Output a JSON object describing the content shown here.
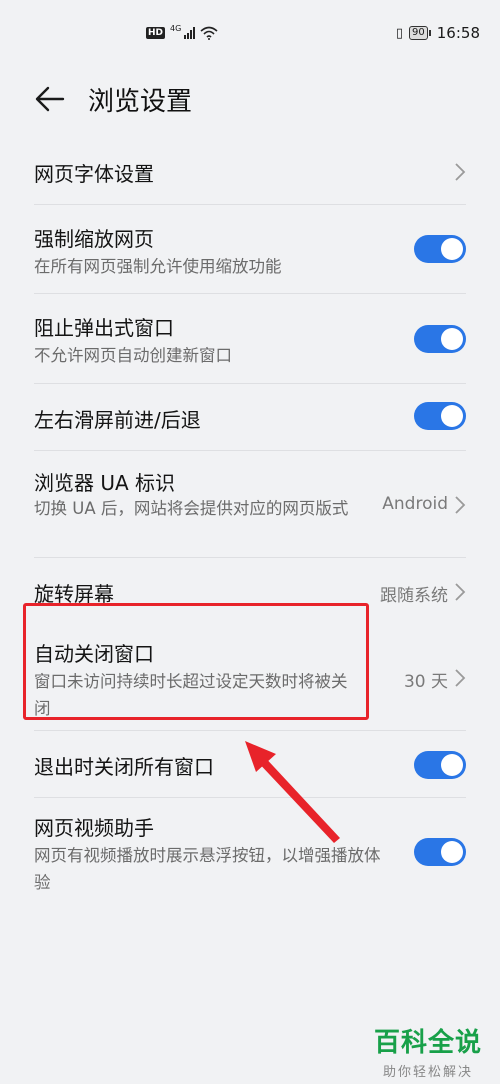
{
  "status_bar": {
    "hd_label": "HD",
    "network_label": "4G",
    "battery_level": "90",
    "time": "16:58"
  },
  "header": {
    "back_icon": "arrow-left-icon",
    "title": "浏览设置"
  },
  "settings": {
    "font_settings": {
      "title": "网页字体设置"
    },
    "force_zoom": {
      "title": "强制缩放网页",
      "subtitle": "在所有网页强制允许使用缩放功能",
      "enabled": true
    },
    "block_popups": {
      "title": "阻止弹出式窗口",
      "subtitle": "不允许网页自动创建新窗口",
      "enabled": true
    },
    "swipe_nav": {
      "title": "左右滑屏前进/后退",
      "enabled": true
    },
    "ua": {
      "title": "浏览器 UA 标识",
      "subtitle": "切换 UA 后，网站将会提供对应的网页版式",
      "value": "Android"
    },
    "rotate": {
      "title": "旋转屏幕",
      "value": "跟随系统"
    },
    "auto_close": {
      "title": "自动关闭窗口",
      "subtitle": "窗口未访问持续时长超过设定天数时将被关闭",
      "value": "30 天"
    },
    "close_on_exit": {
      "title": "退出时关闭所有窗口",
      "enabled": true
    },
    "video_helper": {
      "title": "网页视频助手",
      "subtitle": "网页有视频播放时展示悬浮按钮，以增强播放体验",
      "enabled": true
    }
  },
  "colors": {
    "accent": "#2a76e6",
    "annotation": "#e8232a",
    "watermark": "#18a049"
  },
  "watermark": {
    "brand": "百科全说",
    "tagline": "助你轻松解决"
  }
}
